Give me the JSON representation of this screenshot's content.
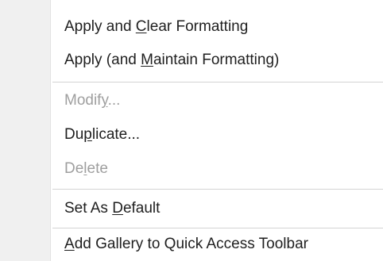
{
  "menu": {
    "items": [
      {
        "pre": "Apply and ",
        "key": "C",
        "post": "lear Formatting",
        "enabled": true
      },
      {
        "pre": "Apply (and ",
        "key": "M",
        "post": "aintain Formatting)",
        "enabled": true
      },
      {
        "pre": "Modif",
        "key": "y",
        "post": "...",
        "enabled": false
      },
      {
        "pre": "Du",
        "key": "p",
        "post": "licate...",
        "enabled": true
      },
      {
        "pre": "De",
        "key": "l",
        "post": "ete",
        "enabled": false
      },
      {
        "pre": "Set As ",
        "key": "D",
        "post": "efault",
        "enabled": true
      },
      {
        "pre": "",
        "key": "A",
        "post": "dd Gallery to Quick Access Toolbar",
        "enabled": true
      }
    ]
  }
}
